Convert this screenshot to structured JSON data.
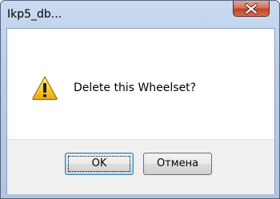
{
  "window": {
    "title": "Ikp5_db..."
  },
  "dialog": {
    "message": "Delete this Wheelset?",
    "icon": "warning-icon"
  },
  "buttons": {
    "ok_label": "OK",
    "cancel_label": "Отмена"
  },
  "colors": {
    "title_bar": "#b7cde9",
    "close_button": "#c2422a",
    "warning_yellow": "#f7d230",
    "button_area": "#f0f0f0"
  }
}
